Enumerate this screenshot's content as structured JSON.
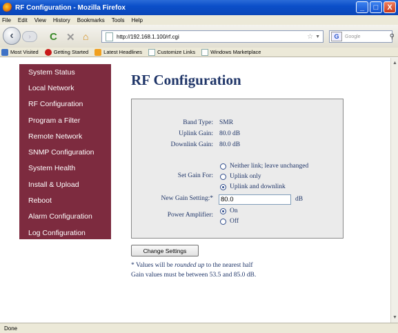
{
  "window": {
    "title": "RF Configuration - Mozilla Firefox",
    "minimize_glyph": "_",
    "maximize_glyph": "□",
    "close_glyph": "X"
  },
  "menubar": [
    "File",
    "Edit",
    "View",
    "History",
    "Bookmarks",
    "Tools",
    "Help"
  ],
  "navbar": {
    "url": "http://192.168.1.100/rf.cgi",
    "search_placeholder": "Google"
  },
  "bookmarks": [
    {
      "label": "Most Visited",
      "icon": "most-visited-icon"
    },
    {
      "label": "Getting Started",
      "icon": "getting-started-icon"
    },
    {
      "label": "Latest Headlines",
      "icon": "rss-icon"
    },
    {
      "label": "Customize Links",
      "icon": "page-icon"
    },
    {
      "label": "Windows Marketplace",
      "icon": "page-icon"
    }
  ],
  "sidebar": {
    "items": [
      {
        "label": "System Status"
      },
      {
        "label": "Local Network"
      },
      {
        "label": "RF Configuration"
      },
      {
        "label": "Program a Filter"
      },
      {
        "label": "Remote Network"
      },
      {
        "label": "SNMP Configuration"
      },
      {
        "label": "System Health"
      },
      {
        "label": "Install & Upload"
      },
      {
        "label": "Reboot"
      },
      {
        "label": "Alarm Configuration"
      },
      {
        "label": "Log Configuration"
      }
    ]
  },
  "main": {
    "title": "RF Configuration",
    "band_type_label": "Band Type:",
    "band_type_value": "SMR",
    "uplink_gain_label": "Uplink Gain:",
    "uplink_gain_value": "80.0 dB",
    "downlink_gain_label": "Downlink Gain:",
    "downlink_gain_value": "80.0 dB",
    "set_gain_label": "Set Gain For:",
    "set_gain_options": [
      {
        "label": "Neither link; leave unchanged",
        "selected": false
      },
      {
        "label": "Uplink only",
        "selected": false
      },
      {
        "label": "Uplink and downlink",
        "selected": true
      }
    ],
    "new_gain_label": "New Gain Setting:*",
    "new_gain_value": "80.0",
    "new_gain_unit": "dB",
    "power_amp_label": "Power Amplifier:",
    "power_amp_options": [
      {
        "label": "On",
        "selected": true
      },
      {
        "label": "Off",
        "selected": false
      }
    ],
    "change_button": "Change Settings",
    "note_prefix": "* Values will be ",
    "note_emph": "rounded up",
    "note_suffix": " to the nearest half",
    "note_line2": "Gain values must be between 53.5 and 85.0 dB."
  },
  "status": "Done"
}
